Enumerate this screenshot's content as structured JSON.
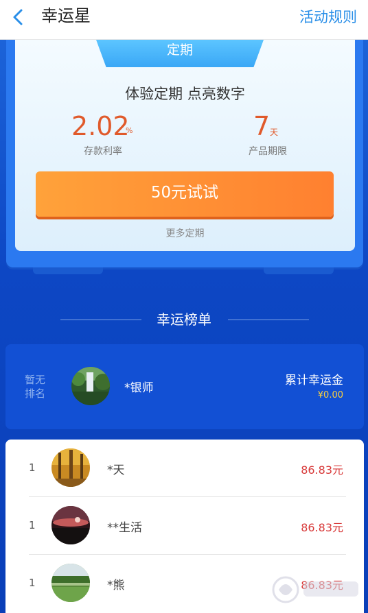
{
  "header": {
    "title": "幸运星",
    "rules_label": "活动规则"
  },
  "product": {
    "badge": "定期",
    "slogan": "体验定期 点亮数字",
    "rate_value": "2.02",
    "rate_unit": "%",
    "rate_label": "存款利率",
    "period_value": "7",
    "period_unit": "天",
    "period_label": "产品期限",
    "cta_label": "50元试试",
    "more_label": "更多定期"
  },
  "leaderboard": {
    "heading": "幸运榜单",
    "me": {
      "rank": "暂无\n排名",
      "name": "*银师",
      "total_label": "累计幸运金",
      "total_value": "¥0.00"
    },
    "rows": [
      {
        "rank": "1",
        "name": "*天",
        "amount": "86.83元"
      },
      {
        "rank": "1",
        "name": "**生活",
        "amount": "86.83元"
      },
      {
        "rank": "1",
        "name": "*熊",
        "amount": "86.83元"
      }
    ]
  },
  "colors": {
    "accent_blue": "#2a8fe8",
    "background": "#0a3fb8",
    "highlight": "#e05a2b",
    "button": "#ff8a30"
  }
}
